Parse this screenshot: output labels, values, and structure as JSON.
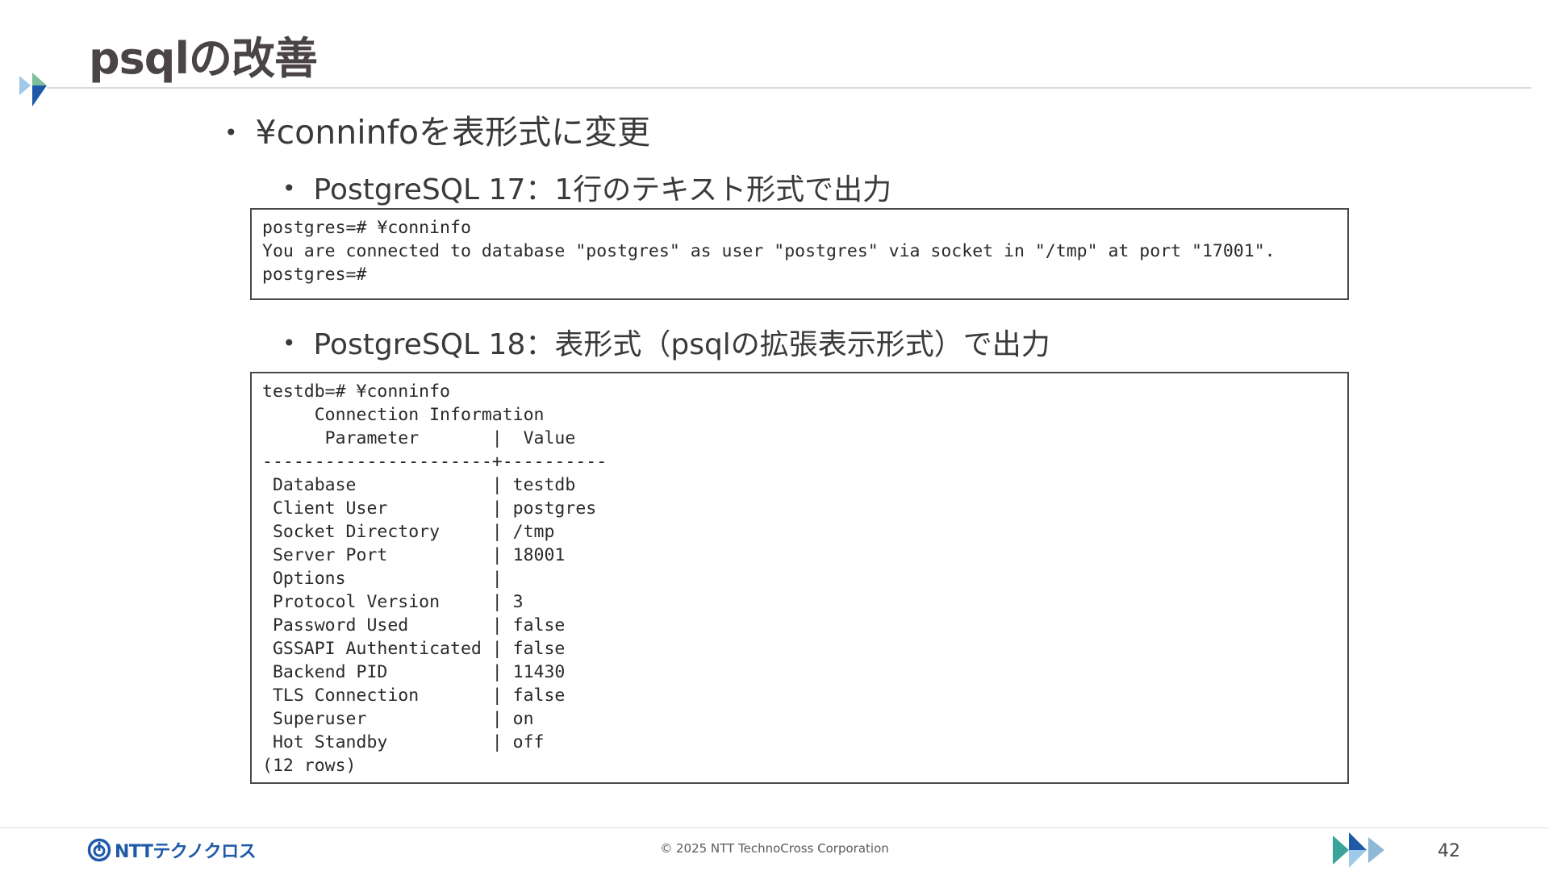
{
  "slide": {
    "title": "psqlの改善",
    "bullets": {
      "main": "¥conninfoを表形式に変更",
      "pg17": "PostgreSQL 17：1行のテキスト形式で出力",
      "pg18": "PostgreSQL 18：表形式（psqlの拡張表示形式）で出力"
    },
    "bullet_glyph": "•"
  },
  "code_pg17": "postgres=# ¥conninfo\nYou are connected to database \"postgres\" as user \"postgres\" via socket in \"/tmp\" at port \"17001\".\npostgres=#",
  "code_pg18": "testdb=# ¥conninfo\n     Connection Information\n      Parameter       |  Value\n----------------------+----------\n Database             | testdb\n Client User          | postgres\n Socket Directory     | /tmp\n Server Port          | 18001\n Options              |\n Protocol Version     | 3\n Password Used        | false\n GSSAPI Authenticated | false\n Backend PID          | 11430\n TLS Connection       | false\n Superuser            | on\n Hot Standby          | off\n(12 rows)",
  "footer": {
    "logo_text": "NTTテクノクロス",
    "copyright": "© 2025 NTT TechnoCross Corporation",
    "page_number": "42"
  },
  "colors": {
    "brand_blue": "#1e5aa8",
    "accent_teal": "#3aa39a",
    "accent_light": "#9ec9e8"
  },
  "icons": {
    "title_mark": "arrow-triangles-icon",
    "footer_mark": "triple-arrow-icon",
    "logo": "ntt-logo-icon"
  }
}
